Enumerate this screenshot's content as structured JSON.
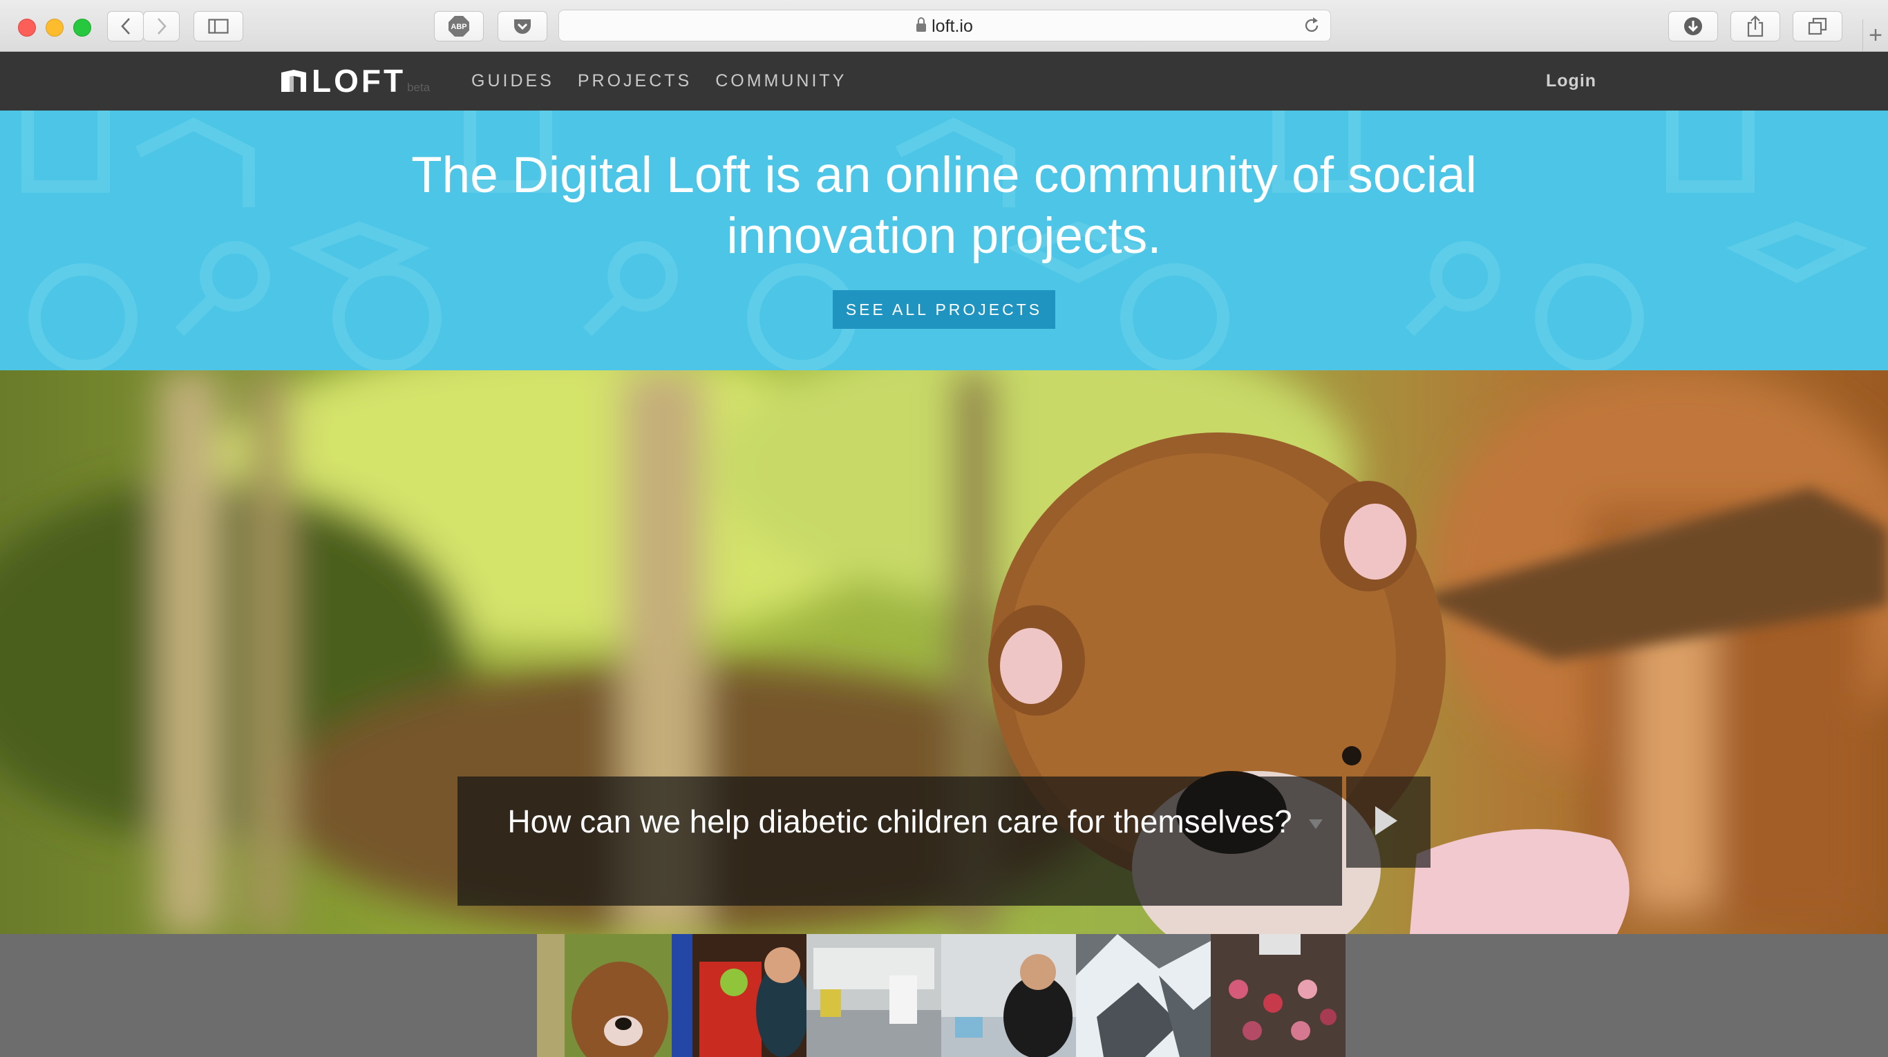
{
  "browser": {
    "url": "loft.io",
    "buttons": [
      "back-icon",
      "forward-icon",
      "sidebar-icon",
      "adblock-icon",
      "pocket-icon",
      "reload-icon",
      "download-icon",
      "share-icon",
      "tabs-icon",
      "new-tab-icon"
    ],
    "adblock_label": "ABP",
    "newtab_label": "+"
  },
  "site": {
    "logo": "LOFT",
    "logo_tag": "beta",
    "nav": [
      {
        "label": "GUIDES"
      },
      {
        "label": "PROJECTS"
      },
      {
        "label": "COMMUNITY"
      }
    ],
    "login": "Login"
  },
  "hero": {
    "headline": "The Digital Loft is an online community of social innovation projects.",
    "cta": "SEE ALL PROJECTS",
    "background": "#4cc5e6"
  },
  "carousel": {
    "caption": "How can we help diabetic children care for themselves?",
    "next_icon": "play-icon",
    "thumbnails": [
      {
        "subject": "teddy-bear"
      },
      {
        "subject": "child-playing"
      },
      {
        "subject": "classroom"
      },
      {
        "subject": "student-desk"
      },
      {
        "subject": "snowy-mountain"
      },
      {
        "subject": "group-workshop"
      }
    ]
  },
  "colors": {
    "nav_bg": "#363636",
    "cta_bg": "#2094c1",
    "page_bg": "#6d6d6d"
  }
}
